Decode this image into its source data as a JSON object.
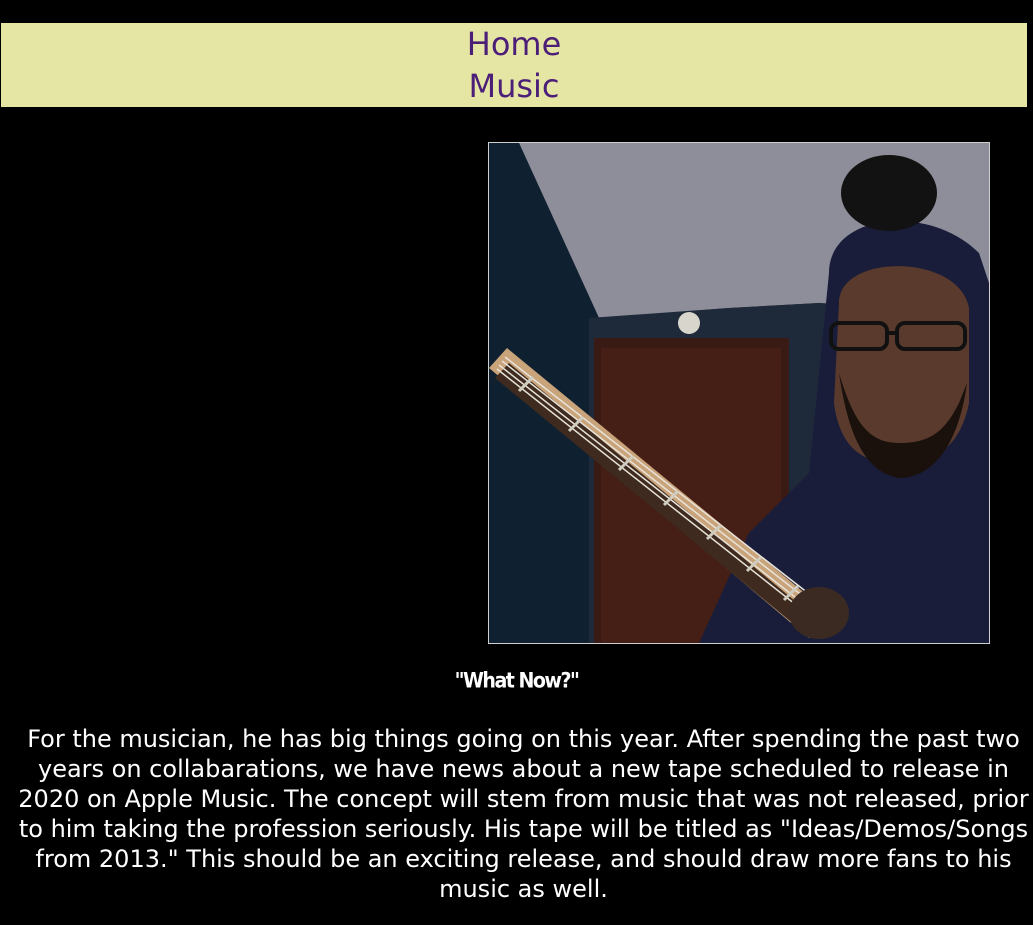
{
  "nav": {
    "items": [
      {
        "label": "Home"
      },
      {
        "label": "Music"
      }
    ],
    "background": "#e6e6a4",
    "link_color": "#4b1e78"
  },
  "main": {
    "photo": {
      "subject": "musician-with-guitar-photo"
    },
    "caption": "\"What Now?\"",
    "paragraph": "For the musician, he has big things going on this year. After spending the past two years on collabarations, we have news about a new tape scheduled to release in 2020 on Apple Music. The concept will stem from music that was not released, prior to him taking the profession seriously. His tape will be titled as \"Ideas/Demos/Songs from 2013.\" This should be an exciting release, and should draw more fans to his music as well."
  },
  "colors": {
    "page_background": "#000000",
    "text": "#ffffff"
  }
}
